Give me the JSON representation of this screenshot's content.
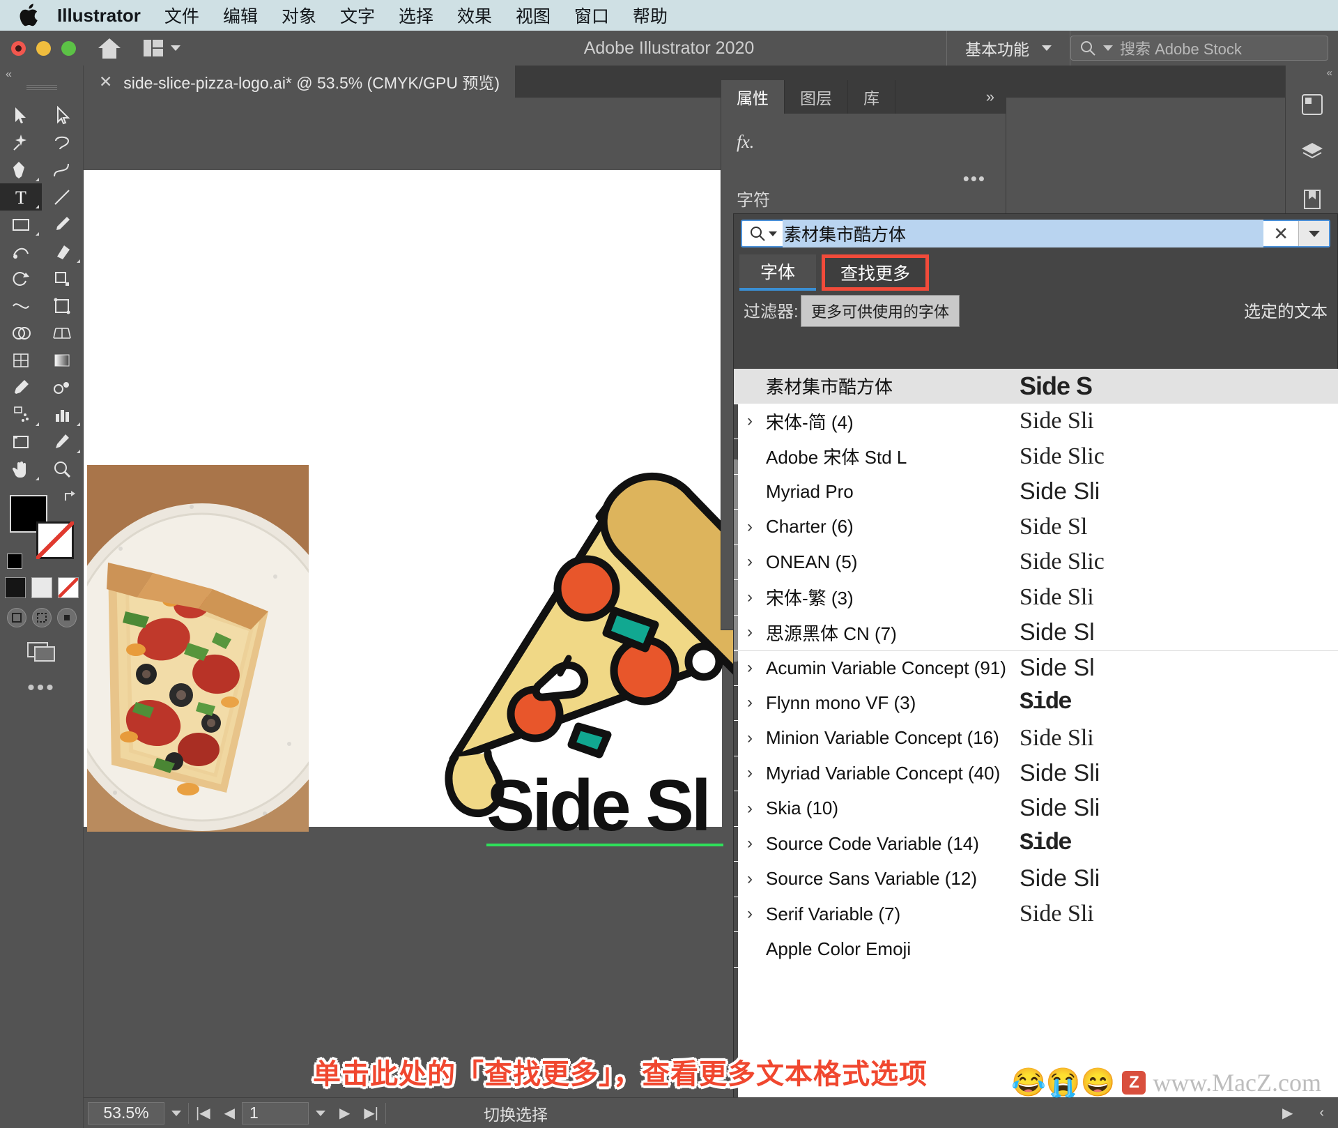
{
  "macmenu": {
    "apple_icon": "apple-logo-icon",
    "app_name": "Illustrator",
    "items": [
      "文件",
      "编辑",
      "对象",
      "文字",
      "选择",
      "效果",
      "视图",
      "窗口",
      "帮助"
    ]
  },
  "titlebar": {
    "title": "Adobe Illustrator 2020",
    "home_icon": "home-icon",
    "arrange_icon": "arrange-documents-icon",
    "workspace": "基本功能",
    "search_placeholder": "搜索 Adobe Stock",
    "search_icon": "search-icon"
  },
  "tab": {
    "close_icon": "close-icon",
    "title": "side-slice-pizza-logo.ai* @ 53.5% (CMYK/GPU 预览)"
  },
  "toolbar": {
    "tools": [
      {
        "name": "selection-tool",
        "glyph": "▲"
      },
      {
        "name": "direct-selection-tool",
        "glyph": "▲"
      },
      {
        "name": "magic-wand-tool",
        "glyph": "✦"
      },
      {
        "name": "lasso-tool",
        "glyph": "◠"
      },
      {
        "name": "pen-tool",
        "glyph": "✒"
      },
      {
        "name": "curvature-tool",
        "glyph": "✎"
      },
      {
        "name": "type-tool",
        "glyph": "T",
        "active": true
      },
      {
        "name": "line-segment-tool",
        "glyph": "╱"
      },
      {
        "name": "rectangle-tool",
        "glyph": "▭"
      },
      {
        "name": "paintbrush-tool",
        "glyph": "🖌"
      },
      {
        "name": "shaper-tool",
        "glyph": "◌"
      },
      {
        "name": "eraser-tool",
        "glyph": "◨"
      },
      {
        "name": "rotate-tool",
        "glyph": "↻"
      },
      {
        "name": "scale-tool",
        "glyph": "⤢"
      },
      {
        "name": "width-tool",
        "glyph": "⌁"
      },
      {
        "name": "free-transform-tool",
        "glyph": "⊞"
      },
      {
        "name": "shape-builder-tool",
        "glyph": "◕"
      },
      {
        "name": "perspective-grid-tool",
        "glyph": "▦"
      },
      {
        "name": "mesh-tool",
        "glyph": "▩"
      },
      {
        "name": "gradient-tool",
        "glyph": "▤"
      },
      {
        "name": "eyedropper-tool",
        "glyph": "✐"
      },
      {
        "name": "blend-tool",
        "glyph": "◎"
      },
      {
        "name": "symbol-sprayer-tool",
        "glyph": "⁂"
      },
      {
        "name": "column-graph-tool",
        "glyph": "▥"
      },
      {
        "name": "artboard-tool",
        "glyph": "▢"
      },
      {
        "name": "slice-tool",
        "glyph": "✂"
      },
      {
        "name": "hand-tool",
        "glyph": "✋"
      },
      {
        "name": "zoom-tool",
        "glyph": "🔍"
      }
    ],
    "fill_color": "#000000",
    "stroke_color": "#ffffff",
    "none_color": "#e03a2f",
    "more_icon": "more-tools-icon"
  },
  "properties_panel": {
    "tabs": [
      {
        "label": "属性",
        "active": true
      },
      {
        "label": "图层",
        "active": false
      },
      {
        "label": "库",
        "active": false
      }
    ],
    "collapse_icon": "chevron-double-right-icon",
    "fx_label": "fx.",
    "more_options_icon": "more-options-icon",
    "section_title": "字符"
  },
  "font_picker": {
    "search_icon": "search-icon",
    "search_value": "素材集市酷方体",
    "clear_icon": "close-icon",
    "dropdown_icon": "chevron-down-icon",
    "tabs": [
      {
        "label": "字体",
        "state": "selected"
      },
      {
        "label": "查找更多",
        "state": "highlighted"
      }
    ],
    "filter_label": "过滤器:",
    "tooltip": "更多可供使用的字体",
    "selected_text_label": "选定的文本",
    "highlight_color": "#f24b3a",
    "accent_color": "#3a8fd4",
    "rows": [
      {
        "name": "素材集市酷方体",
        "expandable": false,
        "highlighted": true,
        "preview": "Side S",
        "style": "bold"
      },
      {
        "name": "宋体-简 (4)",
        "expandable": true,
        "highlighted": false,
        "preview": "Side Sli",
        "style": "normal"
      },
      {
        "name": "Adobe 宋体 Std L",
        "expandable": false,
        "highlighted": false,
        "preview": "Side Slic",
        "style": "serif"
      },
      {
        "name": "Myriad Pro",
        "expandable": false,
        "highlighted": false,
        "preview": "Side Sli",
        "style": "normal"
      },
      {
        "name": "Charter (6)",
        "expandable": true,
        "highlighted": false,
        "preview": "Side Sl",
        "style": "serif"
      },
      {
        "name": "ONEAN (5)",
        "expandable": true,
        "highlighted": false,
        "preview": "Side Slic",
        "style": "normal"
      },
      {
        "name": "宋体-繁 (3)",
        "expandable": true,
        "highlighted": false,
        "preview": "Side Sli",
        "style": "serif"
      },
      {
        "name": "思源黑体 CN (7)",
        "expandable": true,
        "highlighted": false,
        "preview": "Side Sl",
        "style": "normal"
      },
      {
        "name": "Acumin Variable Concept (91)",
        "expandable": true,
        "highlighted": false,
        "preview": "Side Sl",
        "style": "normal",
        "separator": true
      },
      {
        "name": "Flynn mono VF (3)",
        "expandable": true,
        "highlighted": false,
        "preview": "Side",
        "style": "mono"
      },
      {
        "name": "Minion Variable Concept (16)",
        "expandable": true,
        "highlighted": false,
        "preview": "Side Sli",
        "style": "serif"
      },
      {
        "name": "Myriad Variable Concept (40)",
        "expandable": true,
        "highlighted": false,
        "preview": "Side Sli",
        "style": "normal"
      },
      {
        "name": "Skia (10)",
        "expandable": true,
        "highlighted": false,
        "preview": "Side Sli",
        "style": "normal"
      },
      {
        "name": "Source Code Variable (14)",
        "expandable": true,
        "highlighted": false,
        "preview": "Side",
        "style": "mono"
      },
      {
        "name": "Source Sans Variable (12)",
        "expandable": true,
        "highlighted": false,
        "preview": "Side Sli",
        "style": "normal"
      },
      {
        "name": "Serif Variable (7)",
        "expandable": true,
        "highlighted": false,
        "preview": "Side Sli",
        "style": "serif"
      },
      {
        "name": "Apple Color Emoji",
        "expandable": false,
        "highlighted": false,
        "preview": "",
        "style": "normal"
      }
    ]
  },
  "statusbar": {
    "zoom": "53.5%",
    "zoom_dropdown_icon": "chevron-down-icon",
    "first_page_icon": "first-page-icon",
    "prev_page_icon": "prev-page-icon",
    "page": "1",
    "page_dropdown_icon": "chevron-down-icon",
    "next_page_icon": "next-page-icon",
    "last_page_icon": "last-page-icon",
    "status_text": "切换选择",
    "play_icon": "play-icon",
    "back_icon": "back-icon"
  },
  "caption": {
    "text": "单击此处的「查找更多」，查看更多文本格式选项",
    "color": "#f0472f"
  },
  "watermark": {
    "badge": "Z",
    "text": "www.MacZ.com",
    "emoji": "😂😭😄"
  },
  "artwork": {
    "logo_text": "Side Sl",
    "pizza_cheese": "#efd780",
    "pizza_crust": "#ddb45c",
    "pepperoni": "#e8562b",
    "olive_green": "#11a891",
    "outline": "#111111"
  },
  "right_dock": {
    "icons": [
      "properties-dock-icon",
      "layers-dock-icon",
      "libraries-dock-icon",
      "artboards-dock-icon",
      "swatches-dock-icon"
    ]
  }
}
